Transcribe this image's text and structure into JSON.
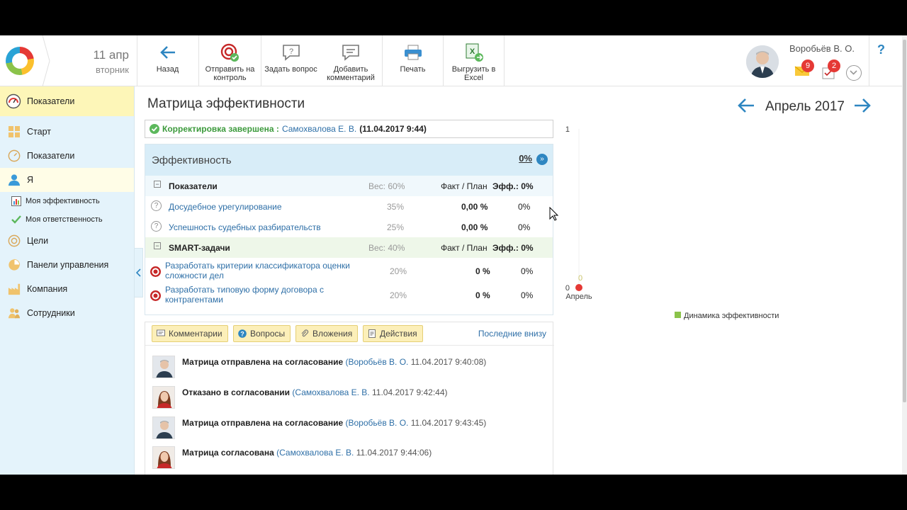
{
  "header": {
    "date_day": "11 апр",
    "date_weekday": "вторник",
    "toolbar": {
      "back": "Назад",
      "send_line1": "Отправить на",
      "send_line2": "контроль",
      "ask": "Задать вопрос",
      "comment_line1": "Добавить",
      "comment_line2": "комментарий",
      "print": "Печать",
      "excel_line1": "Выгрузить в",
      "excel_line2": "Excel"
    },
    "user_name": "Воробьёв В. О.",
    "mail_count": "9",
    "tasks_count": "2",
    "help": "?"
  },
  "sidebar": {
    "header": "Показатели",
    "items": [
      {
        "label": "Старт"
      },
      {
        "label": "Показатели"
      },
      {
        "label": "Я"
      },
      {
        "label": "Моя эффективность"
      },
      {
        "label": "Моя ответственность"
      },
      {
        "label": "Цели"
      },
      {
        "label": "Панели управления"
      },
      {
        "label": "Компания"
      },
      {
        "label": "Сотрудники"
      }
    ]
  },
  "main": {
    "title": "Матрица эффективности",
    "status": {
      "text": "Корректировка завершена :",
      "person": "Самохвалова Е. В.",
      "date": "(11.04.2017 9:44)"
    },
    "efficiency": {
      "title": "Эффективность",
      "value": "0%",
      "groups": [
        {
          "name": "Показатели",
          "weight": "Вес: 60%",
          "fact_plan": "Факт / План",
          "eff": "Эфф.: 0%",
          "rows": [
            {
              "name": "Досудебное урегулирование",
              "weight": "35%",
              "fact": "0,00 %",
              "eff": "0%"
            },
            {
              "name": "Успешность судебных разбирательств",
              "weight": "25%",
              "fact": "0,00 %",
              "eff": "0%"
            }
          ]
        },
        {
          "name": "SMART-задачи",
          "weight": "Вес: 40%",
          "fact_plan": "Факт / План",
          "eff": "Эфф.: 0%",
          "rows": [
            {
              "name_line1": "Разработать критерии классификатора оценки",
              "name_line2": "сложности дел",
              "weight": "20%",
              "fact": "0 %",
              "eff": "0%"
            },
            {
              "name_line1": "Разработать типовую форму договора с",
              "name_line2": "контрагентами",
              "weight": "20%",
              "fact": "0 %",
              "eff": "0%"
            }
          ]
        }
      ]
    },
    "tabs": {
      "comments": "Комментарии",
      "questions": "Вопросы",
      "attachments": "Вложения",
      "actions": "Действия",
      "last_bottom": "Последние внизу"
    },
    "history": [
      {
        "text": "Матрица отправлена на согласование",
        "person": "(Воробьёв В. О.",
        "time": "11.04.2017 9:40:08)"
      },
      {
        "text": "Отказано в согласовании",
        "person": "(Самохвалова Е. В.",
        "time": "11.04.2017 9:42:44)"
      },
      {
        "text": "Матрица отправлена на согласование",
        "person": "(Воробьёв В. О.",
        "time": "11.04.2017 9:43:45)"
      },
      {
        "text": "Матрица согласована",
        "person": "(Самохвалова Е. В.",
        "time": "11.04.2017 9:44:06)"
      }
    ]
  },
  "right": {
    "month": "Апрель 2017"
  },
  "chart_data": {
    "type": "line",
    "categories": [
      "Апрель"
    ],
    "series": [
      {
        "name": "Динамика эффективности",
        "values": [
          0
        ]
      }
    ],
    "data_labels": [
      "0"
    ],
    "y_ticks": [
      "0",
      "1"
    ],
    "ylim": [
      0,
      1
    ],
    "legend": "bottom",
    "colors": {
      "series": "#8bc34a",
      "point": "#e53935"
    }
  },
  "colors": {
    "accent": "#2e86c1",
    "sidebar_bg": "#e4f3fb",
    "active_item": "#fdf6b8",
    "ok": "#5cb85c",
    "badge": "#e53935"
  }
}
